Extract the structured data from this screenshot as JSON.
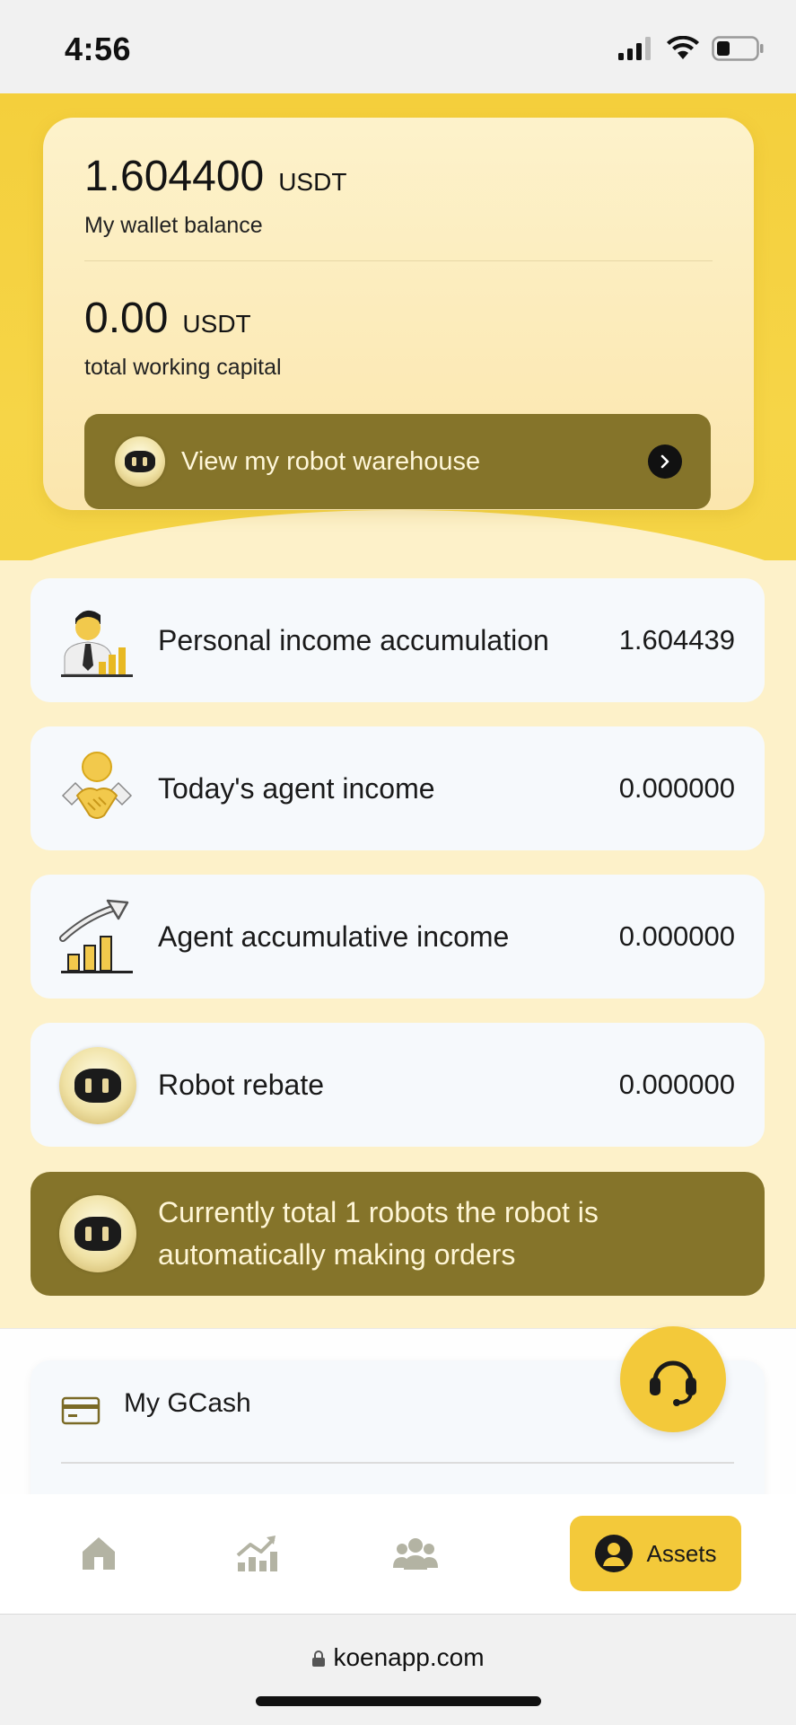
{
  "status_bar": {
    "time": "4:56"
  },
  "wallet": {
    "balance": "1.604400",
    "balance_unit": "USDT",
    "balance_label": "My wallet balance",
    "working_capital": "0.00",
    "working_capital_unit": "USDT",
    "working_capital_label": "total working capital",
    "warehouse_button_label": "View my robot warehouse"
  },
  "income_rows": [
    {
      "title": "Personal income accumulation",
      "value": "1.604439",
      "icon": "businessman-chart-icon"
    },
    {
      "title": "Today's agent income",
      "value": "0.000000",
      "icon": "handshake-coin-icon"
    },
    {
      "title": "Agent accumulative income",
      "value": "0.000000",
      "icon": "growth-chart-icon"
    },
    {
      "title": "Robot rebate",
      "value": "0.000000",
      "icon": "robot-icon"
    }
  ],
  "robots_banner": {
    "text": "Currently total 1 robots the robot is automatically making orders"
  },
  "payment": {
    "gcash_label": "My GCash"
  },
  "tabbar": {
    "items": [
      {
        "name": "home",
        "icon": "home-icon"
      },
      {
        "name": "market",
        "icon": "trend-chart-icon"
      },
      {
        "name": "team",
        "icon": "group-icon"
      },
      {
        "name": "assets",
        "label": "Assets",
        "icon": "user-avatar-icon",
        "active": true
      }
    ]
  },
  "browser": {
    "url": "koenapp.com"
  },
  "colors": {
    "primary_yellow": "#f3c93a",
    "olive": "#85742a",
    "page_bg": "#fdf1c9",
    "row_bg": "#f6f9fc"
  }
}
